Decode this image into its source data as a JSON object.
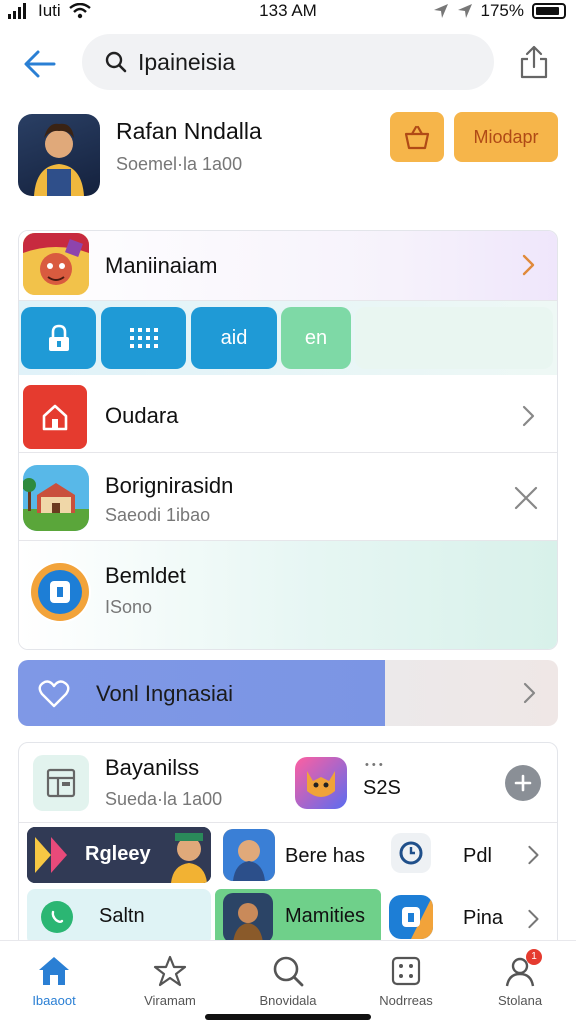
{
  "status_bar": {
    "signal_text": "Iuti",
    "time": "133 AM",
    "battery_text": "175%"
  },
  "search": {
    "query": "Ipaineisia"
  },
  "profile": {
    "name": "Rafan Nndalla",
    "subtitle": "Soemel·la 1a00",
    "action_label": "Miodapr"
  },
  "list1": {
    "item1": {
      "title": "Maniinaiam"
    },
    "quick": [
      {
        "label": "",
        "icon": "lock-icon",
        "color": "#1f9ad6"
      },
      {
        "label": "",
        "icon": "grid-icon",
        "color": "#1f9ad6"
      },
      {
        "label": "aid",
        "icon": "",
        "color": "#1f9ad6"
      },
      {
        "label": "en",
        "icon": "",
        "color": "#7ed9a6"
      }
    ],
    "item2": {
      "title": "Oudara"
    },
    "item3": {
      "title": "Borignirasidn",
      "subtitle": "Saeodi 1ibao"
    },
    "item4": {
      "title": "Bemldet",
      "subtitle": "ISono"
    }
  },
  "banner": {
    "title": "Vonl Ingnasiai"
  },
  "list2": {
    "header": {
      "title": "Bayanilss",
      "subtitle": "Sueda·la 1a00",
      "badge": "S2S",
      "dots": "• • •"
    },
    "tiles": [
      {
        "label": "Rgleey"
      },
      {
        "label": "Bere has"
      },
      {
        "label": "Pdl"
      },
      {
        "label": "Saltn"
      },
      {
        "label": "Mamities"
      },
      {
        "label": "Pina"
      }
    ]
  },
  "tabbar": {
    "tabs": [
      {
        "label": "Ibaaoot",
        "icon": "home-icon",
        "active": true
      },
      {
        "label": "Viramam",
        "icon": "star-icon",
        "active": false
      },
      {
        "label": "Bnovidala",
        "icon": "search-icon",
        "active": false
      },
      {
        "label": "Nodrreas",
        "icon": "grid-icon",
        "active": false
      },
      {
        "label": "Stolana",
        "icon": "person-icon",
        "active": false
      }
    ],
    "badge_count": "1"
  },
  "colors": {
    "accent": "#2a7fd4",
    "action": "#f6b54a",
    "quick_blue": "#1f9ad6",
    "red_tile": "#e53b2f"
  }
}
